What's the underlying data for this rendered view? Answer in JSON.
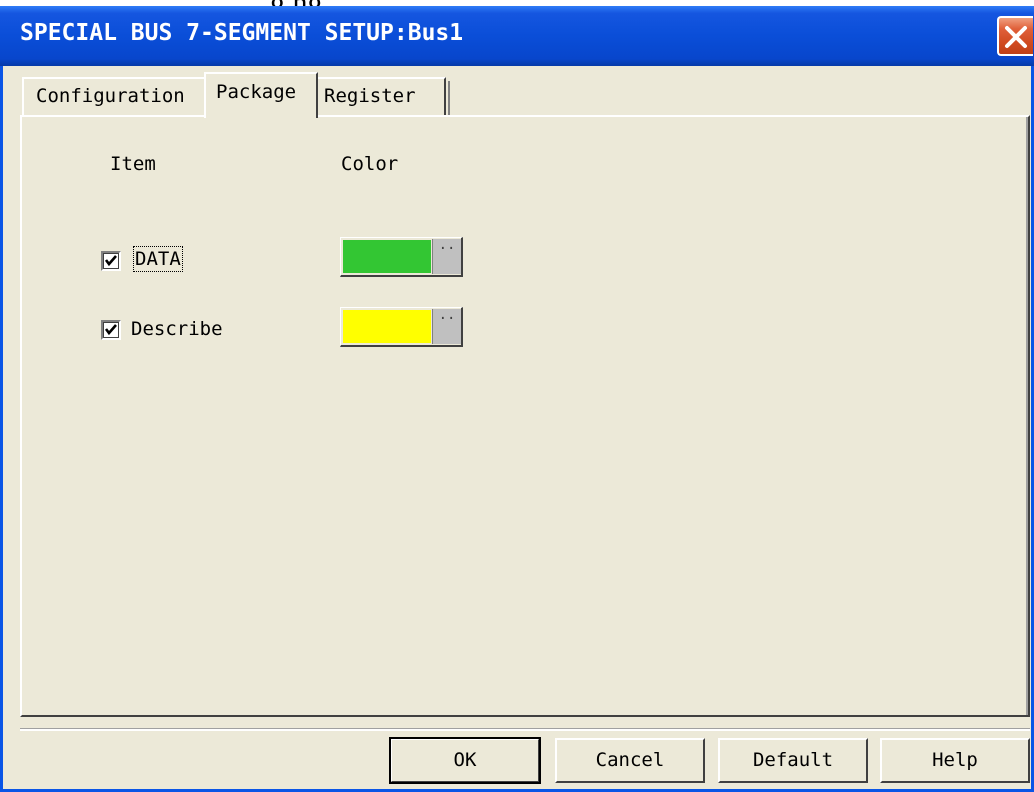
{
  "window": {
    "title": "SPECIAL BUS 7-SEGMENT SETUP:Bus1"
  },
  "background_fragment": "g   ng",
  "tabs": [
    {
      "label": "Configuration",
      "active": false
    },
    {
      "label": "Package",
      "active": true
    },
    {
      "label": "Register",
      "active": false
    }
  ],
  "package": {
    "header_item": "Item",
    "header_color": "Color",
    "rows": [
      {
        "label": "DATA",
        "checked": true,
        "color": "#33c633",
        "picker_label": "··"
      },
      {
        "label": "Describe",
        "checked": true,
        "color": "#ffff00",
        "picker_label": "··"
      }
    ]
  },
  "buttons": {
    "ok": "OK",
    "cancel": "Cancel",
    "default": "Default",
    "help": "Help"
  },
  "colors": {
    "titlebar": "#0a4ed8",
    "dialog_bg": "#ece9d8",
    "close_button": "#d04a20"
  }
}
